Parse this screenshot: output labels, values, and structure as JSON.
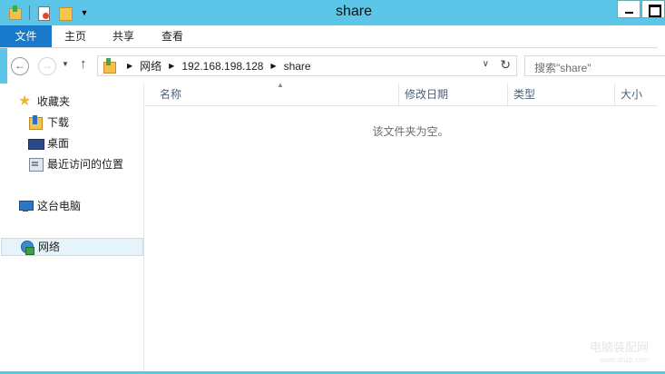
{
  "window": {
    "title": "share"
  },
  "ribbon": {
    "tabs": [
      "文件",
      "主页",
      "共享",
      "查看"
    ]
  },
  "address": {
    "crumbs": [
      "网络",
      "192.168.198.128",
      "share"
    ],
    "search_placeholder": "搜索\"share\""
  },
  "navpane": {
    "favorites": "收藏夹",
    "items": [
      "下载",
      "桌面",
      "最近访问的位置"
    ],
    "this_pc": "这台电脑",
    "network": "网络"
  },
  "content": {
    "columns": [
      "名称",
      "修改日期",
      "类型",
      "大小"
    ],
    "empty_message": "该文件夹为空。"
  },
  "watermark": {
    "line1": "电脑装配网",
    "line2": "www.dnzp.com"
  },
  "colors": {
    "titlebar": "#5bc6e8",
    "file_tab": "#1979ca",
    "selected_nav": "#e5f3fb"
  }
}
